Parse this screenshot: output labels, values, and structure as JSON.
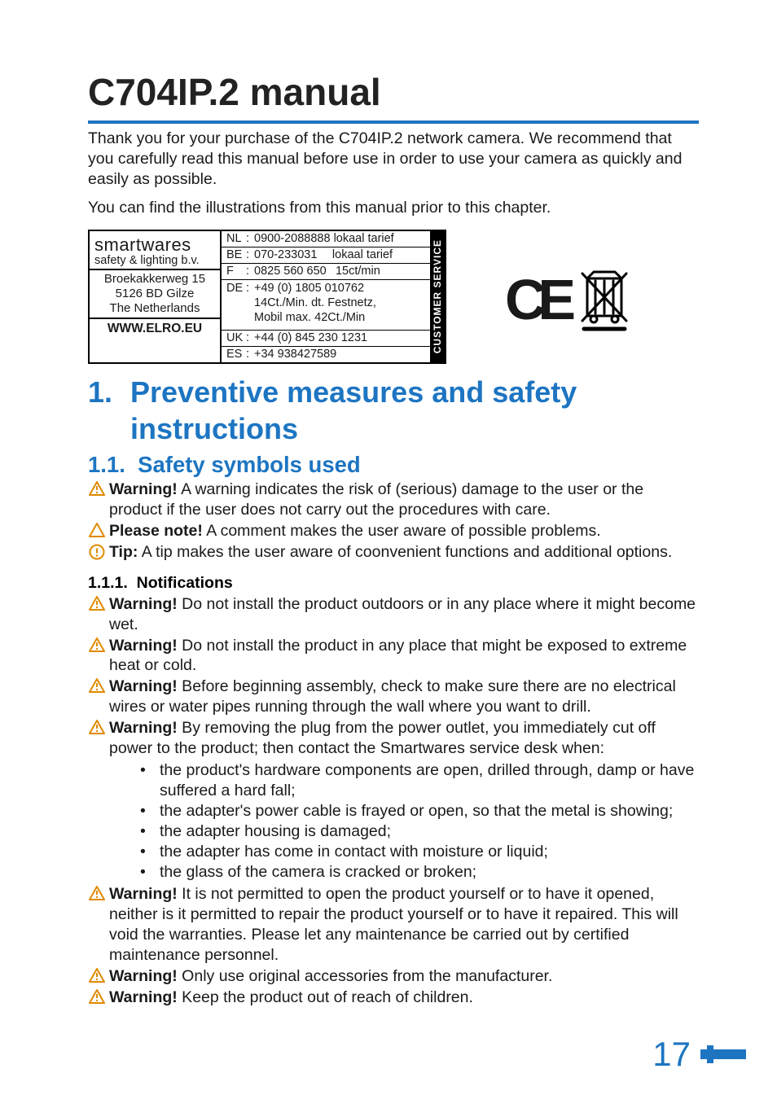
{
  "title": "C704IP.2 manual",
  "intro_p1": "Thank you for your purchase of the C704IP.2 network camera. We recommend that you carefully read this manual before use in order to use your camera as quickly and easily as possible.",
  "intro_p2": "You can find the illustrations from this manual prior to this chapter.",
  "contact": {
    "brand": "smartwares",
    "brand_sub": "safety & lighting b.v.",
    "address_l1": "Broekakkerweg 15",
    "address_l2": "5126 BD Gilze",
    "address_l3": "The Netherlands",
    "website": "WWW.ELRO.EU",
    "side_label": "CUSTOMER SERVICE",
    "rows": {
      "nl": {
        "code": "NL",
        "value": "0900-2088888 lokaal tarief"
      },
      "be": {
        "code": "BE",
        "value": "070-233031  lokaal tarief"
      },
      "fr": {
        "code": "F",
        "value": "0825 560 650  15ct/min"
      },
      "de": {
        "code": "DE",
        "value_l1": "+49 (0) 1805 010762",
        "value_l2": "14Ct./Min. dt. Festnetz,",
        "value_l3": "Mobil max. 42Ct./Min"
      },
      "uk": {
        "code": "UK",
        "value": "+44 (0) 845 230 1231"
      },
      "es": {
        "code": "ES",
        "value": "+34  938427589"
      }
    }
  },
  "marks": {
    "ce": "CE",
    "weee_name": "weee-crossed-bin-icon"
  },
  "chapter": {
    "num": "1.",
    "title": "Preventive measures and safety instructions"
  },
  "section_1_1": {
    "num": "1.1.",
    "title": "Safety symbols used"
  },
  "symbols": {
    "warning_label": "Warning!",
    "warning_text": " A warning indicates the risk of (serious) damage to the user or the product if the user does not carry out the procedures with care.",
    "note_label": "Please note!",
    "note_text": " A comment makes the user aware of possible problems.",
    "tip_label": "Tip:",
    "tip_text": " A tip makes the user aware of coonvenient functions and additional options."
  },
  "subsection_1_1_1": {
    "num": "1.1.1.",
    "title": "Notifications"
  },
  "notif": {
    "w1": " Do not install the product outdoors or in any place where it might become wet.",
    "w2": " Do not install the product in any place that might be exposed to extreme heat or cold.",
    "w3": " Before beginning assembly, check to make sure there are no electrical wires or water pipes running through the wall where you want to drill.",
    "w4": " By removing the plug from the power outlet, you immediately cut off power to the product; then contact the Smartwares service desk when:",
    "bullets": {
      "b1": "the product's hardware components are open, drilled through, damp or have suffered a hard fall;",
      "b2": "the adapter's power cable is frayed or open, so that the metal is showing;",
      "b3": "the adapter housing is damaged;",
      "b4": "the adapter has come in contact with moisture or liquid;",
      "b5": "the glass of the camera is cracked or broken;"
    },
    "w5": " It is not permitted to open the product yourself or to have it opened, neither is it permitted to repair the product yourself or to have it repaired. This will void the warranties. Please let any maintenance be carried out by certified maintenance personnel.",
    "w6": " Only use original accessories from the manufacturer.",
    "w7": " Keep the product out of reach of children."
  },
  "page_number": "17"
}
